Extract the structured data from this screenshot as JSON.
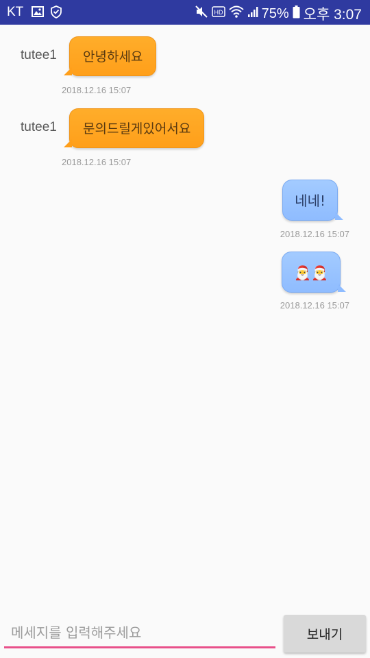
{
  "status_bar": {
    "carrier": "KT",
    "battery": "75%",
    "time": "오후 3:07",
    "icons": [
      "image-icon",
      "shield-check-icon",
      "mute-icon",
      "hd-icon",
      "wifi-icon",
      "signal-icon",
      "battery-icon"
    ]
  },
  "chat": {
    "messages": [
      {
        "side": "left",
        "sender": "tutee1",
        "text": "안녕하세요",
        "timestamp": "2018.12.16 15:07"
      },
      {
        "side": "left",
        "sender": "tutee1",
        "text": "문의드릴게있어서요",
        "timestamp": "2018.12.16 15:07"
      },
      {
        "side": "right",
        "text": "네네!",
        "timestamp": "2018.12.16 15:07"
      },
      {
        "side": "right",
        "text": "🎅🎅",
        "timestamp": "2018.12.16 15:07"
      }
    ]
  },
  "composer": {
    "placeholder": "메세지를 입력해주세요",
    "value": "",
    "send_label": "보내기"
  },
  "colors": {
    "status_bar": "#2f3aa0",
    "received_bubble": "#ff9f1a",
    "sent_bubble": "#8fbcff",
    "input_underline": "#e8508a"
  }
}
